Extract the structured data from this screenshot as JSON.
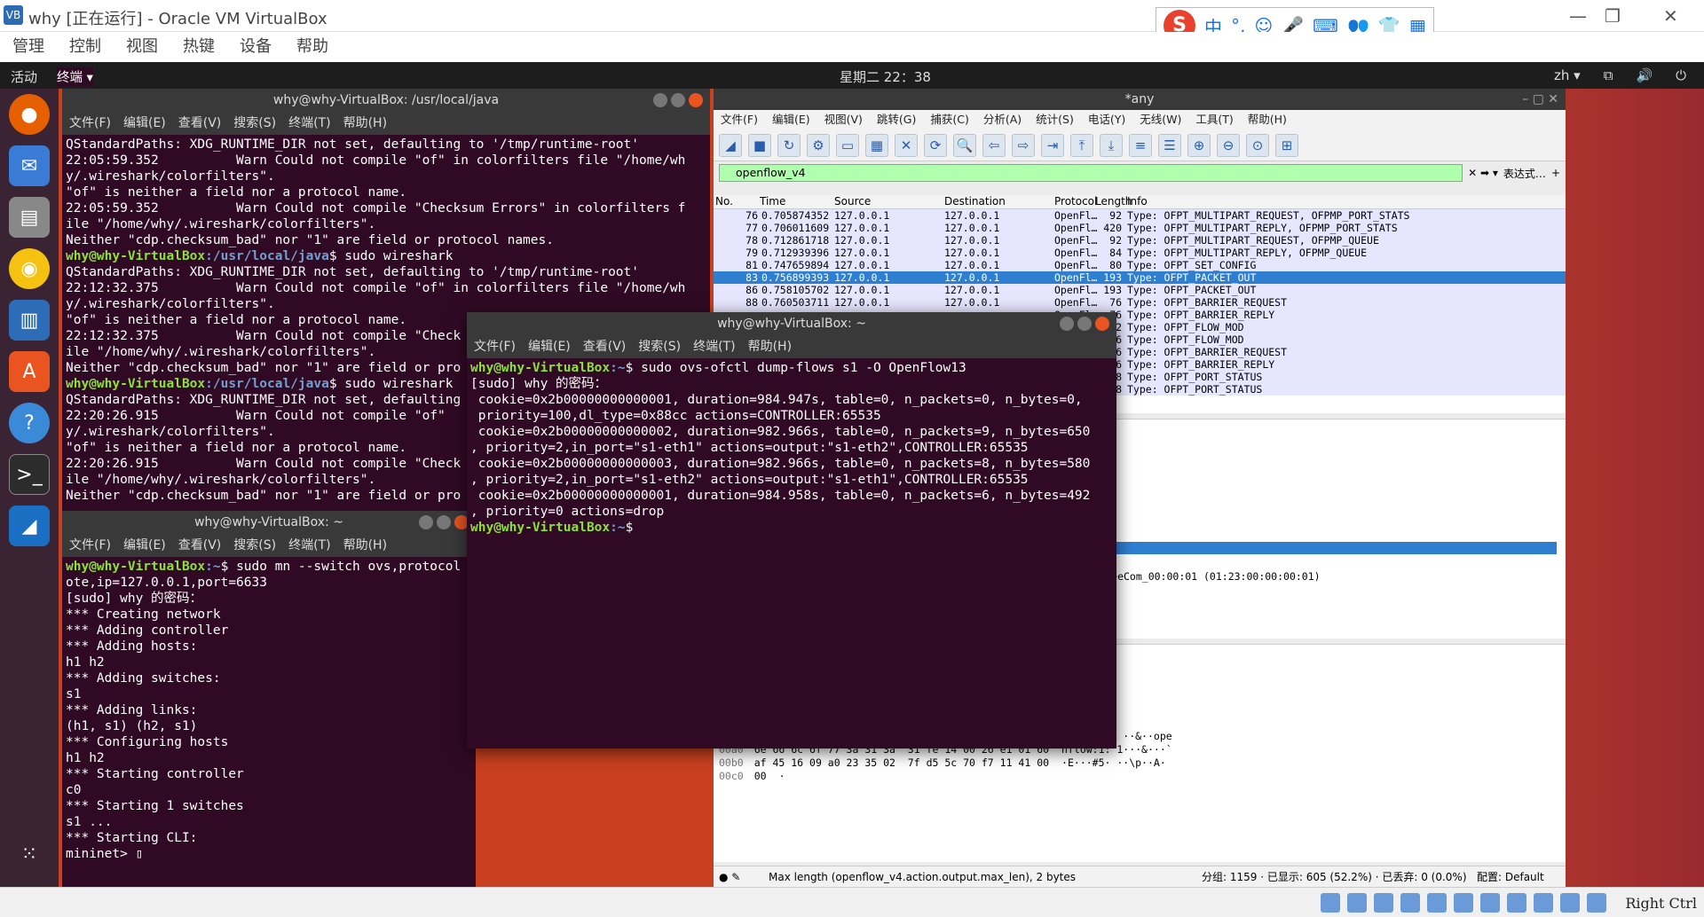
{
  "vbox": {
    "title": "why [正在运行] - Oracle VM VirtualBox",
    "menu": [
      "管理",
      "控制",
      "视图",
      "热键",
      "设备",
      "帮助"
    ],
    "hostkey": "Right Ctrl"
  },
  "ime": {
    "lang": "中"
  },
  "topbar": {
    "activities": "活动",
    "app": "终端 ▾",
    "clock": "星期二 22：38",
    "lang": "zh ▾"
  },
  "term1": {
    "title": "why@why-VirtualBox: /usr/local/java",
    "menu": [
      "文件(F)",
      "编辑(E)",
      "查看(V)",
      "搜索(S)",
      "终端(T)",
      "帮助(H)"
    ],
    "lines": [
      {
        "t": "QStandardPaths: XDG_RUNTIME_DIR not set, defaulting to '/tmp/runtime-root'"
      },
      {
        "t": "22:05:59.352          Warn Could not compile \"of\" in colorfilters file \"/home/wh"
      },
      {
        "t": "y/.wireshark/colorfilters\"."
      },
      {
        "t": "\"of\" is neither a field nor a protocol name."
      },
      {
        "t": "22:05:59.352          Warn Could not compile \"Checksum Errors\" in colorfilters f"
      },
      {
        "t": "ile \"/home/why/.wireshark/colorfilters\"."
      },
      {
        "t": "Neither \"cdp.checksum_bad\" nor \"1\" are field or protocol names."
      },
      {
        "p": "why@why-VirtualBox",
        "d": ":/usr/local/java",
        "c": "$ sudo wireshark"
      },
      {
        "t": "QStandardPaths: XDG_RUNTIME_DIR not set, defaulting to '/tmp/runtime-root'"
      },
      {
        "t": "22:12:32.375          Warn Could not compile \"of\" in colorfilters file \"/home/wh"
      },
      {
        "t": "y/.wireshark/colorfilters\"."
      },
      {
        "t": "\"of\" is neither a field nor a protocol name."
      },
      {
        "t": "22:12:32.375          Warn Could not compile \"Check"
      },
      {
        "t": "ile \"/home/why/.wireshark/colorfilters\"."
      },
      {
        "t": "Neither \"cdp.checksum_bad\" nor \"1\" are field or pro"
      },
      {
        "p": "why@why-VirtualBox",
        "d": ":/usr/local/java",
        "c": "$ sudo wireshark"
      },
      {
        "t": "QStandardPaths: XDG_RUNTIME_DIR not set, defaulting"
      },
      {
        "t": "22:20:26.915          Warn Could not compile \"of\" "
      },
      {
        "t": "y/.wireshark/colorfilters\"."
      },
      {
        "t": "\"of\" is neither a field nor a protocol name."
      },
      {
        "t": "22:20:26.915          Warn Could not compile \"Check"
      },
      {
        "t": "ile \"/home/why/.wireshark/colorfilters\"."
      },
      {
        "t": "Neither \"cdp.checksum_bad\" nor \"1\" are field or pro"
      }
    ]
  },
  "term2": {
    "title": "why@why-VirtualBox: ~",
    "menu": [
      "文件(F)",
      "编辑(E)",
      "查看(V)",
      "搜索(S)",
      "终端(T)",
      "帮助(H)"
    ],
    "lines": [
      {
        "p": "why@why-VirtualBox",
        "d": ":~",
        "c": "$ sudo mn --switch ovs,protocol"
      },
      {
        "t": "ote,ip=127.0.0.1,port=6633"
      },
      {
        "t": "[sudo] why 的密码："
      },
      {
        "t": "*** Creating network"
      },
      {
        "t": "*** Adding controller"
      },
      {
        "t": "*** Adding hosts:"
      },
      {
        "t": "h1 h2"
      },
      {
        "t": "*** Adding switches:"
      },
      {
        "t": "s1"
      },
      {
        "t": "*** Adding links:"
      },
      {
        "t": "(h1, s1) (h2, s1)"
      },
      {
        "t": "*** Configuring hosts"
      },
      {
        "t": "h1 h2"
      },
      {
        "t": "*** Starting controller"
      },
      {
        "t": "c0"
      },
      {
        "t": "*** Starting 1 switches"
      },
      {
        "t": "s1 ..."
      },
      {
        "t": "*** Starting CLI:"
      },
      {
        "t": "mininet> ▯"
      }
    ]
  },
  "term3": {
    "title": "why@why-VirtualBox: ~",
    "menu": [
      "文件(F)",
      "编辑(E)",
      "查看(V)",
      "搜索(S)",
      "终端(T)",
      "帮助(H)"
    ],
    "lines": [
      {
        "p": "why@why-VirtualBox",
        "d": ":~",
        "c": "$ sudo ovs-ofctl dump-flows s1 -O OpenFlow13"
      },
      {
        "t": "[sudo] why 的密码："
      },
      {
        "t": " cookie=0x2b00000000000001, duration=984.947s, table=0, n_packets=0, n_bytes=0,"
      },
      {
        "t": " priority=100,dl_type=0x88cc actions=CONTROLLER:65535"
      },
      {
        "t": " cookie=0x2b00000000000002, duration=982.966s, table=0, n_packets=9, n_bytes=650"
      },
      {
        "t": ", priority=2,in_port=\"s1-eth1\" actions=output:\"s1-eth2\",CONTROLLER:65535"
      },
      {
        "t": " cookie=0x2b00000000000003, duration=982.966s, table=0, n_packets=8, n_bytes=580"
      },
      {
        "t": ", priority=2,in_port=\"s1-eth2\" actions=output:\"s1-eth1\",CONTROLLER:65535"
      },
      {
        "t": " cookie=0x2b00000000000001, duration=984.958s, table=0, n_packets=6, n_bytes=492"
      },
      {
        "t": ", priority=0 actions=drop"
      },
      {
        "p": "why@why-VirtualBox",
        "d": ":~",
        "c": "$"
      }
    ]
  },
  "ws": {
    "title": "*any",
    "menu": [
      "文件(F)",
      "编辑(E)",
      "视图(V)",
      "跳转(G)",
      "捕获(C)",
      "分析(A)",
      "统计(S)",
      "电话(Y)",
      "无线(W)",
      "工具(T)",
      "帮助(H)"
    ],
    "filter": "openflow_v4",
    "expr": "表达式…",
    "cols": [
      "No.",
      "Time",
      "Source",
      "Destination",
      "Protocol",
      "Length",
      "Info"
    ],
    "rows": [
      [
        "76",
        "0.705874352",
        "127.0.0.1",
        "127.0.0.1",
        "OpenFl…",
        "92",
        "Type: OFPT_MULTIPART_REQUEST, OFPMP_PORT_STATS"
      ],
      [
        "77",
        "0.706011609",
        "127.0.0.1",
        "127.0.0.1",
        "OpenFl…",
        "420",
        "Type: OFPT_MULTIPART_REPLY, OFPMP_PORT_STATS"
      ],
      [
        "78",
        "0.712861718",
        "127.0.0.1",
        "127.0.0.1",
        "OpenFl…",
        "92",
        "Type: OFPT_MULTIPART_REQUEST, OFPMP_QUEUE"
      ],
      [
        "79",
        "0.712939396",
        "127.0.0.1",
        "127.0.0.1",
        "OpenFl…",
        "84",
        "Type: OFPT_MULTIPART_REPLY, OFPMP_QUEUE"
      ],
      [
        "81",
        "0.747659894",
        "127.0.0.1",
        "127.0.0.1",
        "OpenFl…",
        "80",
        "Type: OFPT_SET_CONFIG"
      ],
      [
        "83",
        "0.756899393",
        "127.0.0.1",
        "127.0.0.1",
        "OpenFl…",
        "193",
        "Type: OFPT_PACKET_OUT"
      ],
      [
        "86",
        "0.758105702",
        "127.0.0.1",
        "127.0.0.1",
        "OpenFl…",
        "193",
        "Type: OFPT_PACKET_OUT"
      ],
      [
        "88",
        "0.760503711",
        "127.0.0.1",
        "127.0.0.1",
        "OpenFl…",
        "76",
        "Type: OFPT_BARRIER_REQUEST"
      ],
      [
        "",
        "",
        "",
        "",
        "OpenFl…",
        "76",
        "Type: OFPT_BARRIER_REPLY"
      ],
      [
        "",
        "",
        "",
        "",
        "OpenFl…",
        "132",
        "Type: OFPT_FLOW_MOD"
      ],
      [
        "",
        "",
        "",
        "",
        "OpenFl…",
        "156",
        "Type: OFPT_FLOW_MOD"
      ],
      [
        "",
        "",
        "",
        "",
        "OpenFl…",
        "76",
        "Type: OFPT_BARRIER_REQUEST"
      ],
      [
        "",
        "",
        "",
        "",
        "OpenFl…",
        "76",
        "Type: OFPT_BARRIER_REPLY"
      ],
      [
        "",
        "",
        "",
        "",
        "OpenFl…",
        "148",
        "Type: OFPT_PORT_STATUS"
      ],
      [
        "",
        "",
        "",
        "",
        "OpenFl…",
        "148",
        "Type: OFPT_PORT_STATUS"
      ]
    ],
    "detail": "), Dst: CayeeCom_00:00:01 (01:23:00:00:00:01)",
    "hex": [
      [
        "0090",
        "6e 66 6c 6f 77 3a 31 fe  10 00 26 e1 00 6f 70 65",
        "nflow:1·  ··&··ope"
      ],
      [
        "00a0",
        "6e 66 6c 6f 77 3a 31 3a  31 fe 14 00 26 e1 01 60",
        "nflow:1: 1···&···`"
      ],
      [
        "00b0",
        "af 45 16 09 a0 23 35 02  7f d5 5c 70 f7 11 41 00",
        "·E···#5· ··\\p··A·"
      ],
      [
        "00c0",
        "00",
        "·"
      ]
    ],
    "status_msg": "Max length (openflow_v4.action.output.max_len), 2 bytes",
    "status_right": "分组: 1159 · 已显示: 605 (52.2%) · 已丢弃: 0 (0.0%)",
    "profile": "配置: Default"
  }
}
